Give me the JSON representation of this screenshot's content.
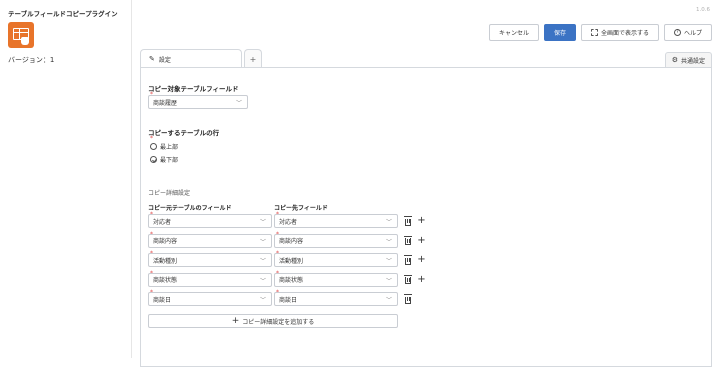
{
  "sidebar": {
    "app_title": "テーブルフィールドコピープラグイン",
    "version_label": "バージョン：1"
  },
  "header": {
    "version_corner": "1.0.6"
  },
  "toolbar": {
    "cancel_label": "キャンセル",
    "save_label": "保存",
    "fullscreen_label": "全画面で表示する",
    "help_label": "ヘルプ"
  },
  "tabs": {
    "settings_label": "設定",
    "add_tab_label": "+",
    "common_settings_label": "共通設定"
  },
  "target_table": {
    "title": "コピー対象テーブルフィールド",
    "value": "商談履歴"
  },
  "copy_row": {
    "title": "コピーするテーブルの行",
    "options": [
      "最上部",
      "最下部"
    ],
    "selected": "最下部"
  },
  "mapping": {
    "section_label": "コピー詳細設定",
    "source_header": "コピー元テーブルのフィールド",
    "target_header": "コピー先フィールド",
    "rows": [
      {
        "source": "対応者",
        "target": "対応者"
      },
      {
        "source": "商談内容",
        "target": "商談内容"
      },
      {
        "source": "活動種別",
        "target": "活動種別"
      },
      {
        "source": "商談状態",
        "target": "商談状態"
      },
      {
        "source": "商談日",
        "target": "商談日"
      }
    ],
    "add_button_label": "コピー詳細設定を追加する"
  }
}
